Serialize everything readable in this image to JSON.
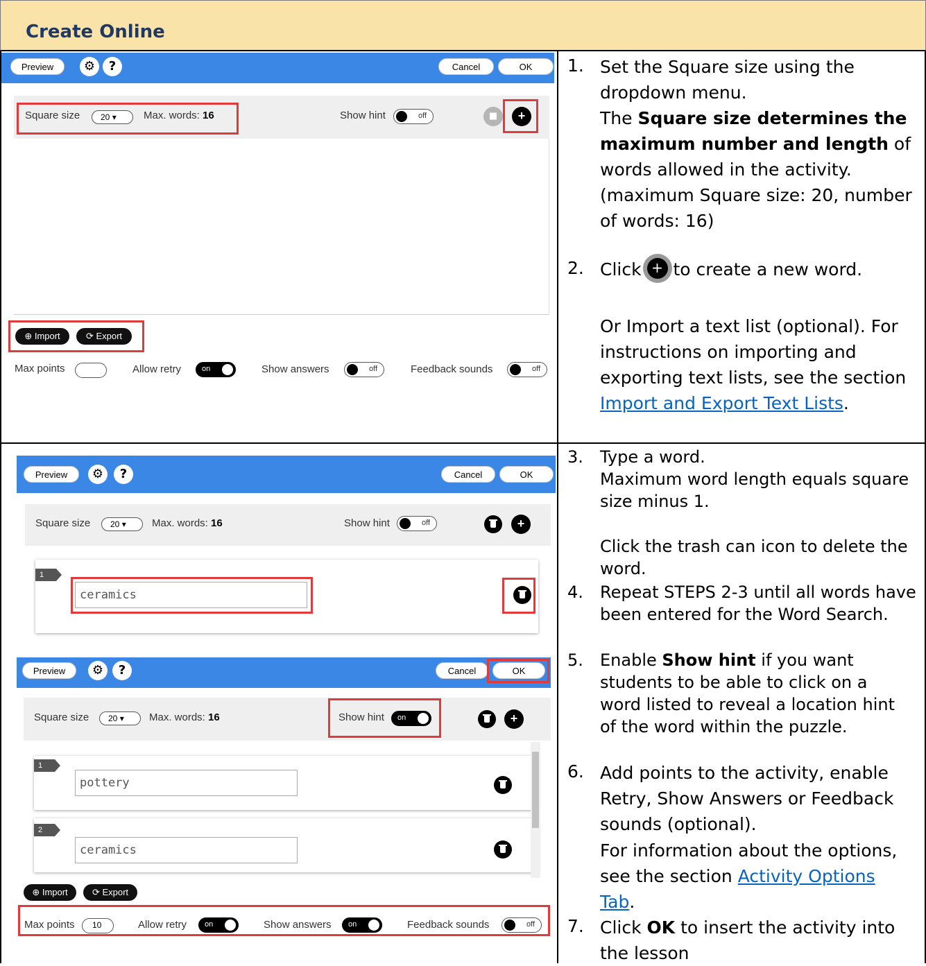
{
  "header_title": "Create Online",
  "ui": {
    "preview": "Preview",
    "cancel": "Cancel",
    "ok": "OK",
    "gear": "⚙",
    "help": "?",
    "square_size_label": "Square size",
    "square_size_value": "20",
    "max_words_label": "Max. words:",
    "max_words_value": "16",
    "show_hint": "Show hint",
    "import": "Import",
    "export": "Export",
    "max_points": "Max points",
    "max_points_value": "10",
    "allow_retry": "Allow retry",
    "show_answers": "Show answers",
    "feedback_sounds": "Feedback sounds",
    "on": "on",
    "off": "off",
    "word1": "ceramics",
    "word_pottery": "pottery",
    "word_ceramics": "ceramics",
    "tag1": "1",
    "tag2": "2"
  },
  "steps": {
    "s1_num": "1.",
    "s1_a": "Set the Square size using the dropdown menu.",
    "s1_b_pre": "The ",
    "s1_b_bold": "Square size determines the maximum number and length",
    "s1_b_post": " of words allowed in the activity. (maximum Square size: 20, number of words: 16)",
    "s2_num": "2.",
    "s2_pre": "Click",
    "s2_post": "to create a new word.",
    "s2_or": "Or Import a text list (optional). For instructions on importing and exporting text lists, see the section ",
    "s2_link": "Import and Export Text Lists",
    "s2_end": ".",
    "s3_num": "3.",
    "s3_a": "Type a word.",
    "s3_b": "Maximum word length equals square size minus 1.",
    "s3_c": "Click the trash can icon to delete the word.",
    "s4_num": "4.",
    "s4": "Repeat STEPS 2-3 until all words have been entered for the Word Search.",
    "s5_num": "5.",
    "s5_pre": "Enable ",
    "s5_bold": "Show hint",
    "s5_post": " if you want students to be able to click on a word listed to reveal a location hint of the word within the puzzle.",
    "s6_num": "6.",
    "s6_a": "Add points to the activity, enable Retry, Show Answers or Feedback sounds (optional).",
    "s6_b": "For information about the options, see the section ",
    "s6_link": "Activity Options Tab",
    "s6_end": ".",
    "s7_num": "7.",
    "s7_pre": "Click ",
    "s7_bold": "OK",
    "s7_post": " to insert the activity into the lesson"
  }
}
